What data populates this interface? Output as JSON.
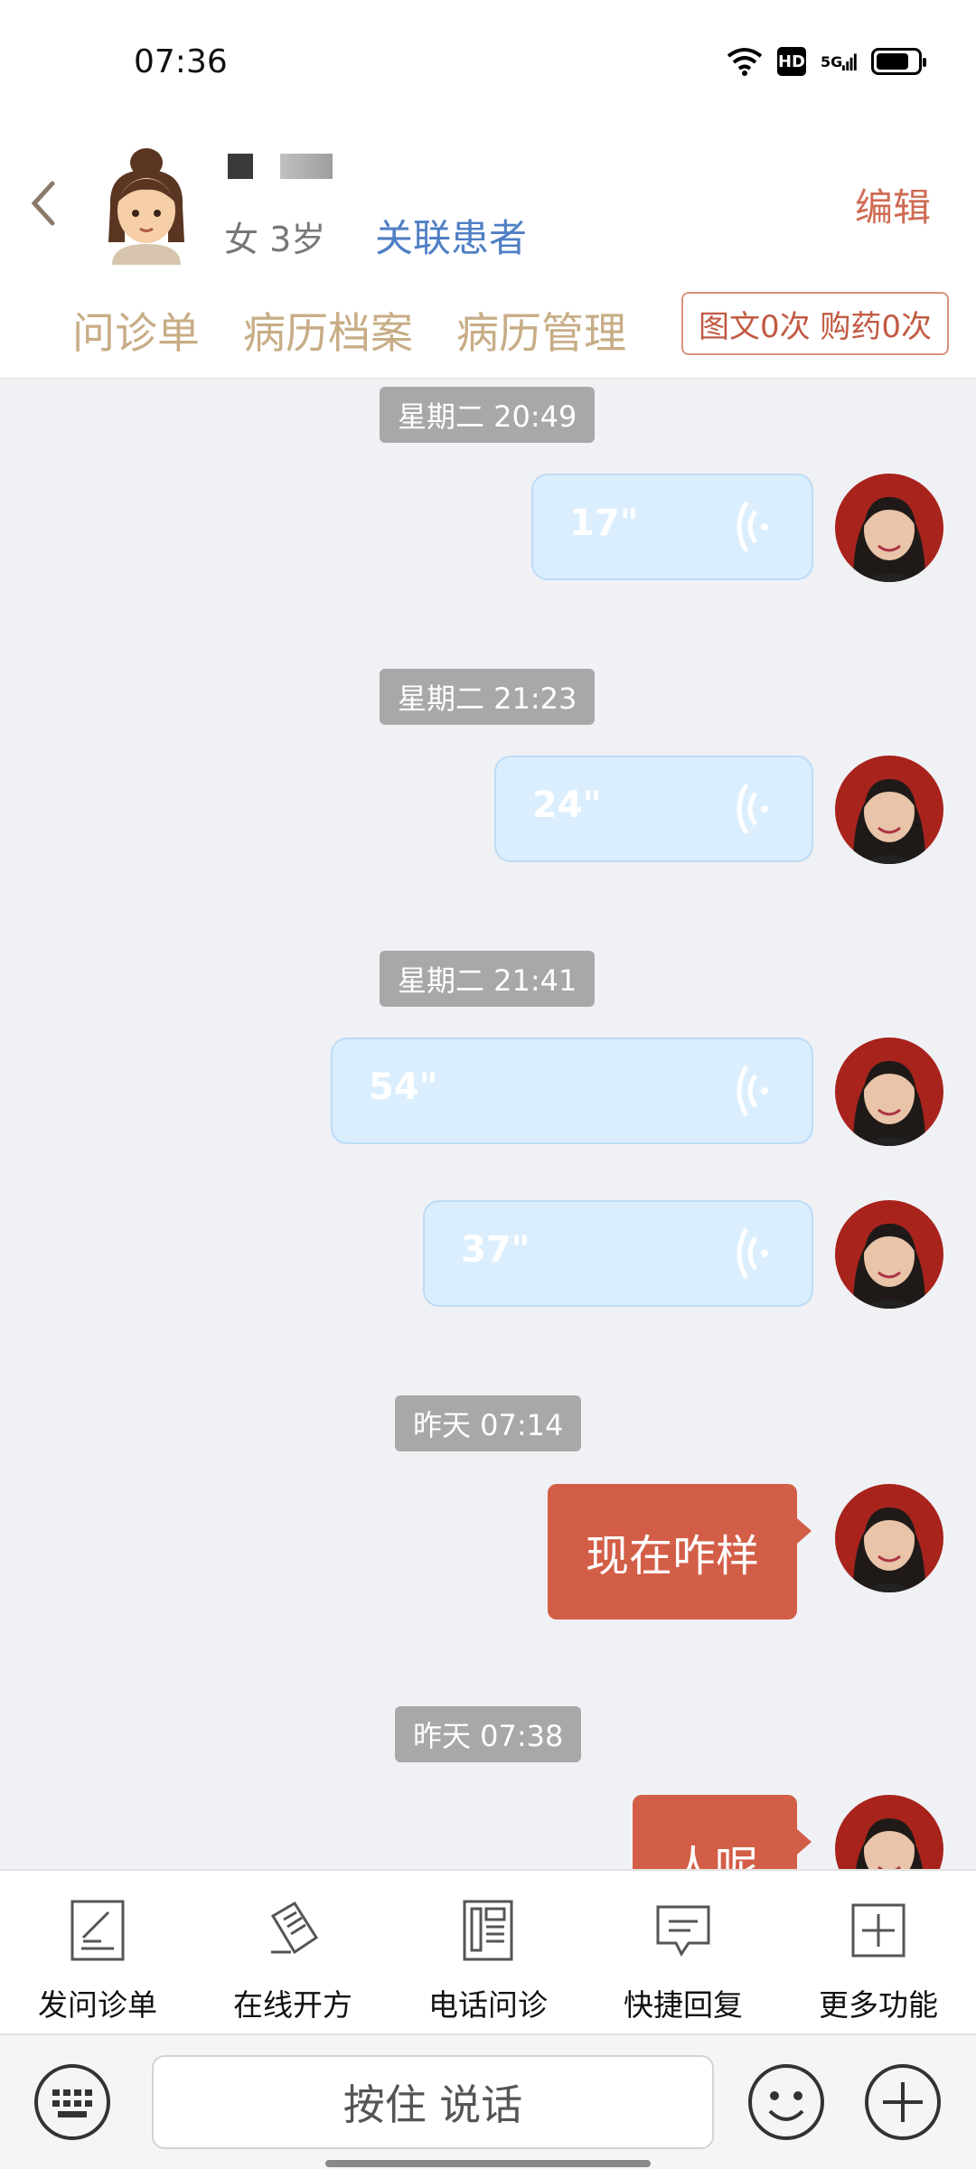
{
  "status_bar": {
    "time": "07:36",
    "hd": "HD",
    "network": "5G",
    "battery_level": 0.8
  },
  "header": {
    "info": "女 3岁",
    "link": "关联患者",
    "edit": "编辑",
    "tabs": [
      "问诊单",
      "病历档案",
      "病历管理"
    ],
    "badge": "图文0次 购药0次"
  },
  "chat": {
    "messages": [
      {
        "timestamp": "星期二 20:49",
        "duration": "17\""
      },
      {
        "timestamp": "星期二 21:23",
        "duration": "24\""
      },
      {
        "timestamp": "星期二 21:41",
        "duration": "54\""
      },
      {
        "timestamp": "",
        "duration": "37\""
      },
      {
        "timestamp": "昨天 07:14",
        "text": "现在咋样"
      },
      {
        "timestamp": "昨天 07:38",
        "text": "人呢"
      }
    ]
  },
  "toolbar": {
    "items": [
      {
        "label": "发问诊单",
        "icon": "form-icon"
      },
      {
        "label": "在线开方",
        "icon": "prescription-icon"
      },
      {
        "label": "电话问诊",
        "icon": "phone-icon"
      },
      {
        "label": "快捷回复",
        "icon": "quick-reply-icon"
      },
      {
        "label": "更多功能",
        "icon": "more-icon"
      }
    ]
  },
  "input": {
    "hold_to_talk": "按住 说话"
  },
  "colors": {
    "accent": "#d35e47",
    "voice_bubble": "#dbeefd",
    "tab_text": "#c7ad86",
    "link": "#4f7fc5"
  }
}
